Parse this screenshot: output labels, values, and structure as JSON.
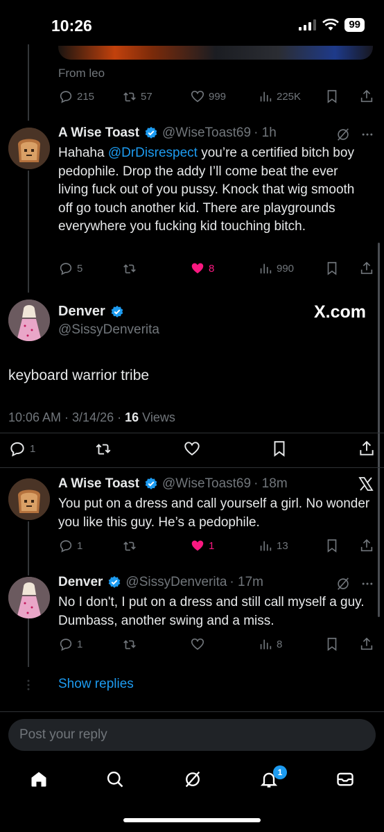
{
  "status_bar": {
    "time": "10:26",
    "battery": "99"
  },
  "prev_tweet": {
    "source": "From leo",
    "actions": {
      "replies": "215",
      "reposts": "57",
      "likes": "999",
      "views": "225K"
    }
  },
  "reply1": {
    "name": "A Wise Toast",
    "handle": "@WiseToast69",
    "time": "· 1h",
    "text_before": "Hahaha ",
    "mention": "@DrDisrespect",
    "text_after": " you’re a certified bitch boy pedophile. Drop the addy I’ll come beat the ever living fuck out of you pussy. Knock that wig smooth off go touch another kid. There are playgrounds everywhere you fucking kid touching bitch.",
    "actions": {
      "replies": "5",
      "reposts": "",
      "likes": "8",
      "views": "990"
    }
  },
  "main_tweet": {
    "name": "Denver",
    "handle": "@SissyDenverita",
    "brand": "X.com",
    "text": "keyboard warrior tribe",
    "timestamp": "10:06 AM · 3/14/26 · ",
    "views_count": "16",
    "views_label": " Views",
    "actions": {
      "replies": "1"
    }
  },
  "reply2": {
    "name": "A Wise Toast",
    "handle": "@WiseToast69",
    "time": "· 18m",
    "text": "You put on a dress and call yourself a girl. No wonder you like this guy. He’s a pedophile.",
    "actions": {
      "replies": "1",
      "likes": "1",
      "views": "13"
    }
  },
  "reply3": {
    "name": "Denver",
    "handle": "@SissyDenverita",
    "time": "· 17m",
    "text": "No I don't,  I put on a dress and still call myself a guy.  Dumbass, another swing and a miss.",
    "actions": {
      "replies": "1",
      "views": "8"
    }
  },
  "show_replies": "Show replies",
  "reply_box": {
    "placeholder": "Post your reply"
  },
  "nav": {
    "notifications_badge": "1"
  },
  "colors": {
    "accent": "#1d9bf0",
    "like": "#f91880",
    "muted": "#71767b",
    "text": "#e7e9ea"
  }
}
